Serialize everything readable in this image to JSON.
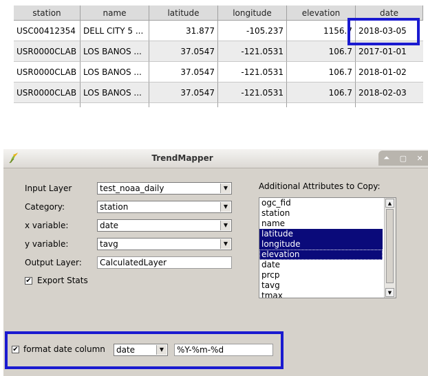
{
  "table": {
    "headers": [
      "station",
      "name",
      "latitude",
      "longitude",
      "elevation",
      "date"
    ],
    "rows": [
      [
        "USC00412354",
        "DELL CITY 5 ...",
        "31.877",
        "-105.237",
        "1156.7",
        "2018-03-05"
      ],
      [
        "USR0000CLAB",
        "LOS BANOS ...",
        "37.0547",
        "-121.0531",
        "106.7",
        "2017-01-01"
      ],
      [
        "USR0000CLAB",
        "LOS BANOS ...",
        "37.0547",
        "-121.0531",
        "106.7",
        "2018-01-02"
      ],
      [
        "USR0000CLAB",
        "LOS BANOS ...",
        "37.0547",
        "-121.0531",
        "106.7",
        "2018-02-03"
      ]
    ]
  },
  "dialog": {
    "title": "TrendMapper",
    "input_layer_label": "Input Layer",
    "input_layer_value": "test_noaa_daily",
    "category_label": "Category:",
    "category_value": "station",
    "x_label": "x variable:",
    "x_value": "date",
    "y_label": "y variable:",
    "y_value": "tavg",
    "output_label": "Output Layer:",
    "output_value": "CalculatedLayer",
    "export_label": "Export Stats",
    "export_checked": "✔",
    "attrs_label": "Additional Attributes to Copy:",
    "attrs": [
      "ogc_fid",
      "station",
      "name",
      "latitude",
      "longitude",
      "elevation",
      "date",
      "prcp",
      "tavg",
      "tmax"
    ],
    "format_label": "format date column",
    "format_checked": "✔",
    "format_column": "date",
    "format_pattern": "%Y-%m-%d"
  },
  "colors": {
    "highlight": "#1a1ad0",
    "selection": "#0a0a7a"
  }
}
